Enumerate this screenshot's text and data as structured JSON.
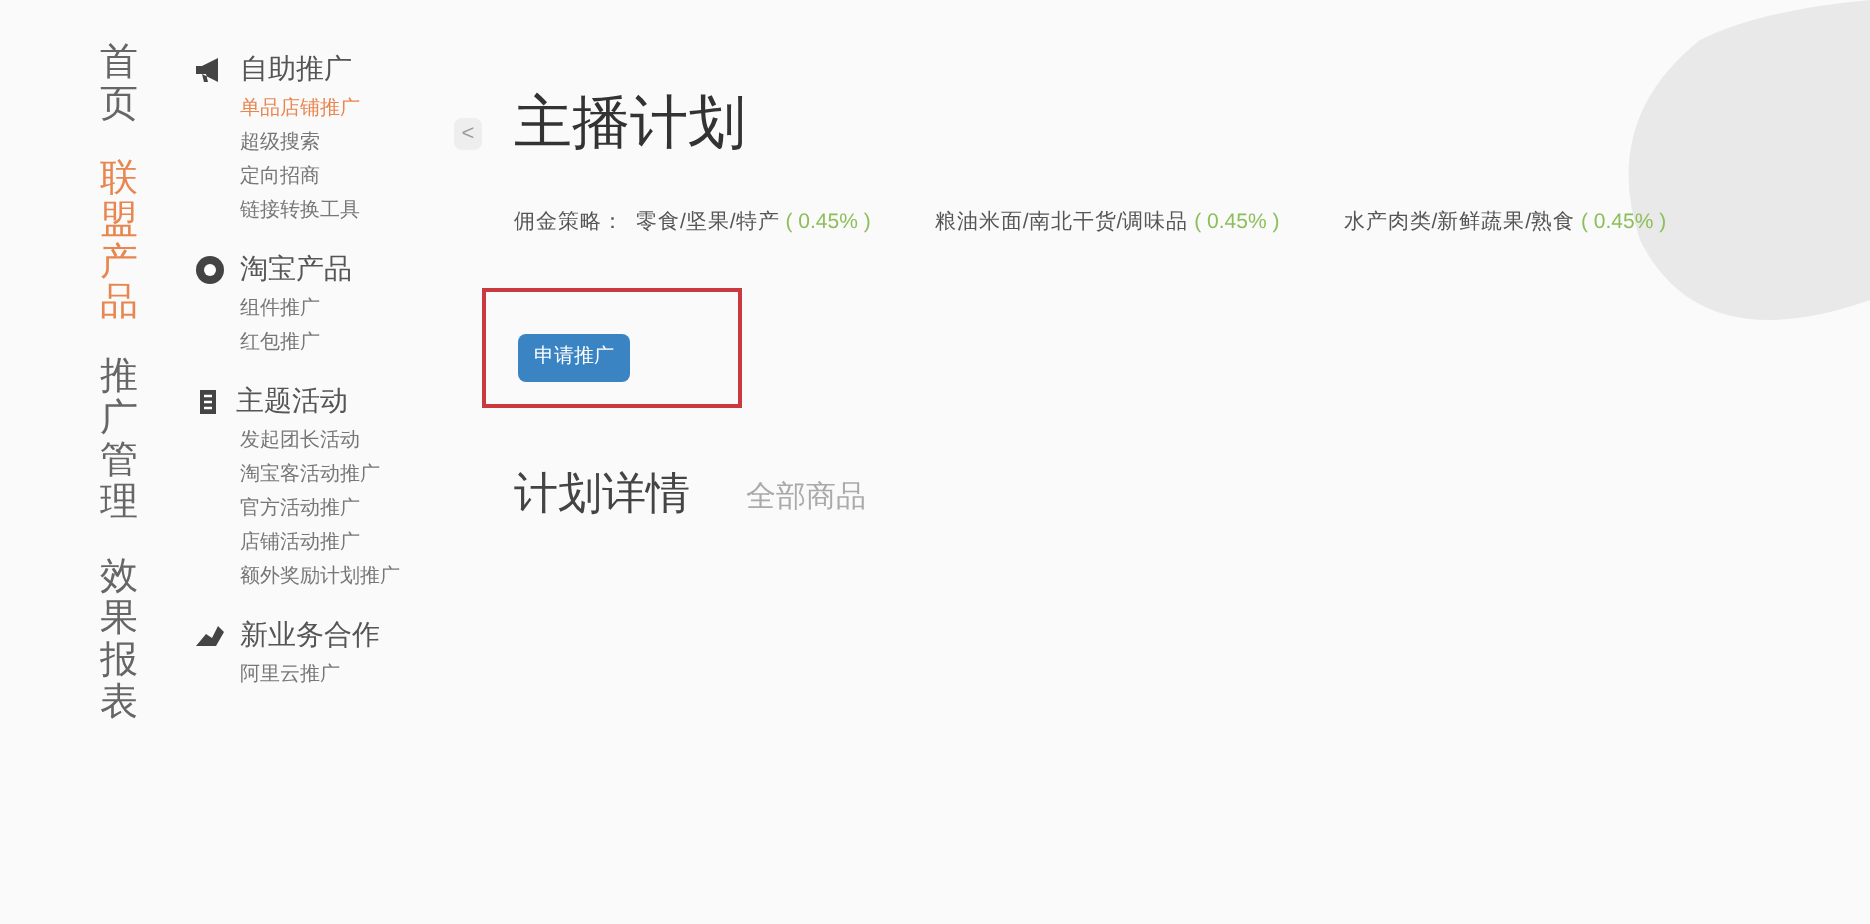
{
  "main_nav": [
    {
      "label": "首页",
      "selected": false
    },
    {
      "label": "联盟产品",
      "selected": true
    },
    {
      "label": "推广管理",
      "selected": false
    },
    {
      "label": "效果报表",
      "selected": false
    }
  ],
  "collapse_button": {
    "label": "<"
  },
  "sidebar": {
    "groups": [
      {
        "title": "自助推广",
        "items": [
          {
            "label": "单品店铺推广",
            "selected": true
          },
          {
            "label": "超级搜索",
            "selected": false
          },
          {
            "label": "定向招商",
            "selected": false
          },
          {
            "label": "链接转换工具",
            "selected": false
          }
        ]
      },
      {
        "title": "淘宝产品",
        "items": [
          {
            "label": "组件推广",
            "selected": false
          },
          {
            "label": "红包推广",
            "selected": false
          }
        ]
      },
      {
        "title": "主题活动",
        "items": [
          {
            "label": "发起团长活动",
            "selected": false
          },
          {
            "label": "淘宝客活动推广",
            "selected": false
          },
          {
            "label": "官方活动推广",
            "selected": false
          },
          {
            "label": "店铺活动推广",
            "selected": false
          },
          {
            "label": "额外奖励计划推广",
            "selected": false
          }
        ]
      },
      {
        "title": "新业务合作",
        "items": [
          {
            "label": "阿里云推广",
            "selected": false
          }
        ]
      }
    ]
  },
  "page_title": "主播计划",
  "commission": {
    "label": "佣金策略：",
    "entries": [
      {
        "category": "零食/坚果/特产",
        "rate": "( 0.45% )"
      },
      {
        "category": "粮油米面/南北干货/调味品",
        "rate": "( 0.45% )"
      },
      {
        "category": "水产肉类/新鲜蔬果/熟食",
        "rate": "( 0.45% )"
      }
    ]
  },
  "apply_button": {
    "label": "申请推广",
    "highlighted": true
  },
  "tabs": [
    {
      "label": "计划详情",
      "selected": true
    },
    {
      "label": "全部商品",
      "selected": false
    }
  ]
}
